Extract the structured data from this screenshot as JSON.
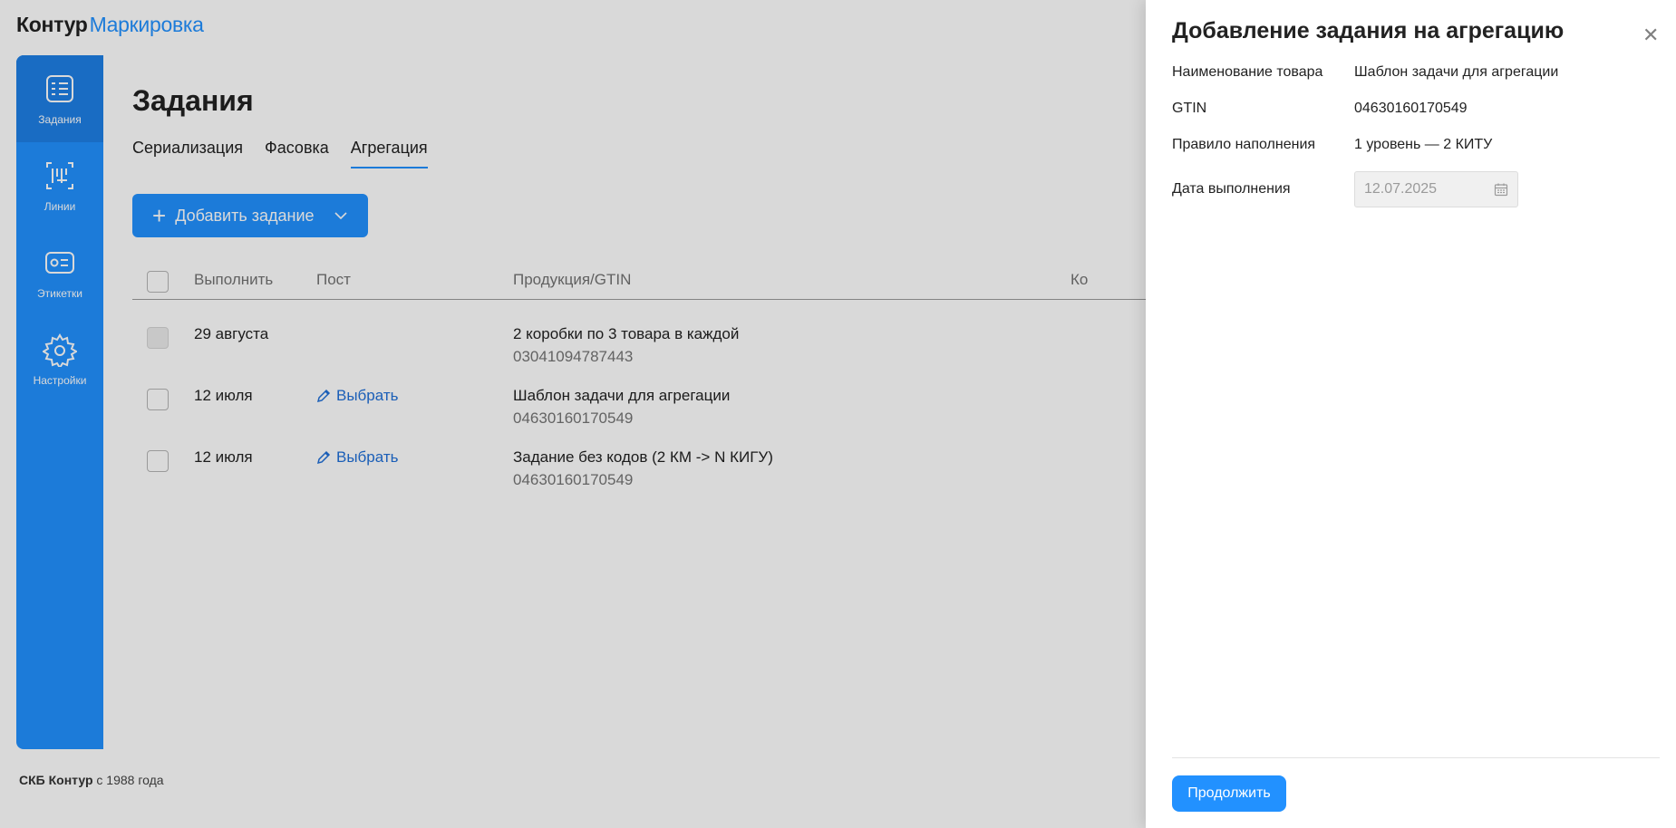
{
  "app": {
    "brand_bold": "Контур",
    "brand_product": "Маркировка"
  },
  "sidebar": {
    "items": [
      {
        "label": "Задания",
        "icon": "tasks-icon",
        "active": true
      },
      {
        "label": "Линии",
        "icon": "lines-icon"
      },
      {
        "label": "Этикетки",
        "icon": "labels-icon"
      },
      {
        "label": "Настройки",
        "icon": "gear-icon"
      }
    ]
  },
  "main": {
    "title": "Задания",
    "tabs": [
      {
        "label": "Сериализация"
      },
      {
        "label": "Фасовка"
      },
      {
        "label": "Агрегация",
        "active": true
      }
    ],
    "add_button_label": "Добавить задание",
    "table": {
      "headers": {
        "execute": "Выполнить",
        "post": "Пост",
        "product": "Продукция/GTIN",
        "truncated": "Ко"
      },
      "rows": [
        {
          "date": "29 августа",
          "post": "",
          "product": "2 коробки по 3 товара в каждой",
          "gtin": "03041094787443",
          "checkbox_disabled": true
        },
        {
          "date": "12 июля",
          "post": "Выбрать",
          "product": "Шаблон задачи для агрегации",
          "gtin": "04630160170549"
        },
        {
          "date": "12 июля",
          "post": "Выбрать",
          "product": "Задание без кодов (2 КМ -> N КИГУ)",
          "gtin": "04630160170549"
        }
      ]
    }
  },
  "footer": {
    "company": "СКБ Контур",
    "since": "с 1988 года"
  },
  "panel": {
    "title": "Добавление задания на агрегацию",
    "fields": [
      {
        "label": "Наименование товара",
        "value": "Шаблон задачи для агрегации"
      },
      {
        "label": "GTIN",
        "value": "04630160170549"
      },
      {
        "label": "Правило наполнения",
        "value": "1 уровень — 2 КИТУ"
      }
    ],
    "date_label": "Дата выполнения",
    "date_value": "12.07.2025",
    "continue_label": "Продолжить"
  },
  "colors": {
    "accent": "#2291ff",
    "sidebar_active": "#1e7fe6",
    "link": "#1f6fd8"
  }
}
